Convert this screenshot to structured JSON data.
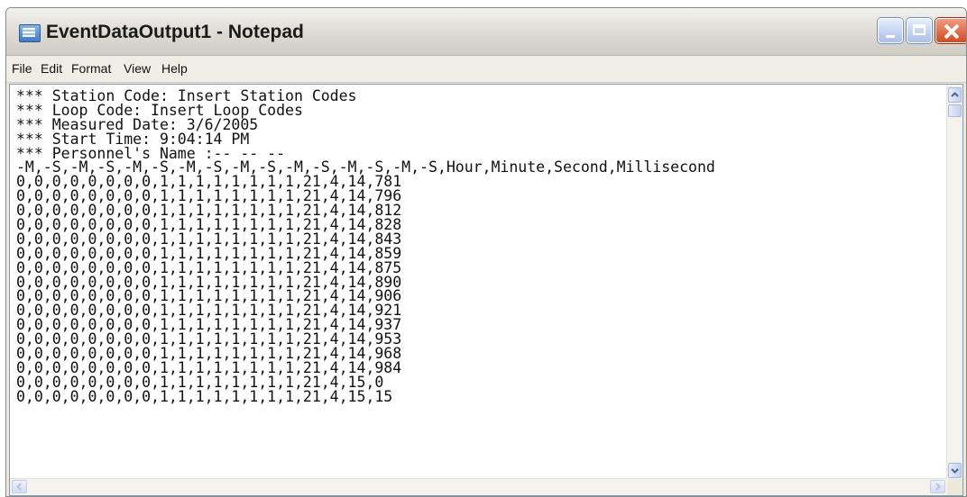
{
  "window": {
    "title": "EventDataOutput1 - Notepad"
  },
  "menu": {
    "items": [
      "File",
      "Edit",
      "Format",
      "View",
      "Help"
    ]
  },
  "editor": {
    "lines": [
      "*** Station Code: Insert Station Codes",
      "*** Loop Code: Insert Loop Codes",
      "*** Measured Date: 3/6/2005",
      "*** Start Time: 9:04:14 PM",
      "*** Personnel's Name :-- -- --",
      "-M,-S,-M,-S,-M,-S,-M,-S,-M,-S,-M,-S,-M,-S,-M,-S,Hour,Minute,Second,Millisecond",
      "0,0,0,0,0,0,0,0,1,1,1,1,1,1,1,1,21,4,14,781",
      "0,0,0,0,0,0,0,0,1,1,1,1,1,1,1,1,21,4,14,796",
      "0,0,0,0,0,0,0,0,1,1,1,1,1,1,1,1,21,4,14,812",
      "0,0,0,0,0,0,0,0,1,1,1,1,1,1,1,1,21,4,14,828",
      "0,0,0,0,0,0,0,0,1,1,1,1,1,1,1,1,21,4,14,843",
      "0,0,0,0,0,0,0,0,1,1,1,1,1,1,1,1,21,4,14,859",
      "0,0,0,0,0,0,0,0,1,1,1,1,1,1,1,1,21,4,14,875",
      "0,0,0,0,0,0,0,0,1,1,1,1,1,1,1,1,21,4,14,890",
      "0,0,0,0,0,0,0,0,1,1,1,1,1,1,1,1,21,4,14,906",
      "0,0,0,0,0,0,0,0,1,1,1,1,1,1,1,1,21,4,14,921",
      "0,0,0,0,0,0,0,0,1,1,1,1,1,1,1,1,21,4,14,937",
      "0,0,0,0,0,0,0,0,1,1,1,1,1,1,1,1,21,4,14,953",
      "0,0,0,0,0,0,0,0,1,1,1,1,1,1,1,1,21,4,14,968",
      "0,0,0,0,0,0,0,0,1,1,1,1,1,1,1,1,21,4,14,984",
      "0,0,0,0,0,0,0,0,1,1,1,1,1,1,1,1,21,4,15,0",
      "0,0,0,0,0,0,0,0,1,1,1,1,1,1,1,1,21,4,15,15"
    ]
  },
  "icons": {
    "app": "notepad-icon",
    "minimize": "minimize-icon",
    "maximize": "maximize-icon",
    "close": "close-icon",
    "scroll_up": "arrow-up-icon",
    "scroll_down": "arrow-down-icon",
    "scroll_left": "arrow-left-icon",
    "scroll_right": "arrow-right-icon"
  },
  "colors": {
    "title_bar": "#dcdad3",
    "close_button": "#d34a21",
    "editor_background": "#ffffff"
  }
}
